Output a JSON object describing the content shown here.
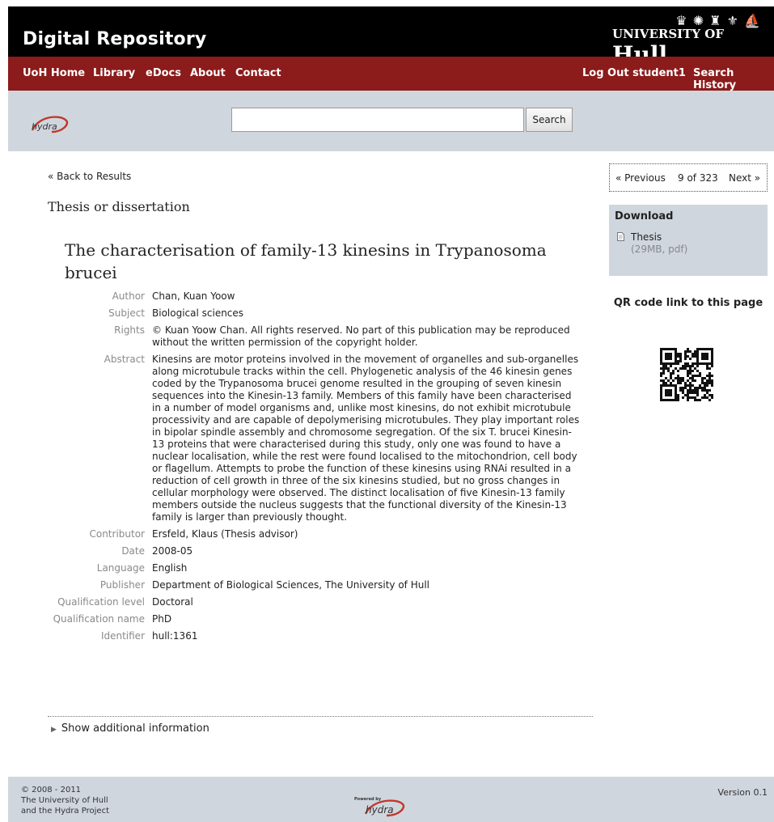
{
  "header": {
    "site_title": "Digital Repository",
    "uoh_logo_small": "UNIVERSITY OF",
    "uoh_logo_big": "Hull"
  },
  "nav": {
    "uoh_home": "UoH Home",
    "library": "Library",
    "edocs": "eDocs",
    "about": "About",
    "contact": "Contact",
    "logout": "Log Out student1",
    "search_history": "Search History"
  },
  "search": {
    "value": "",
    "button": "Search",
    "logo_text": "hydra"
  },
  "record": {
    "back": "« Back to Results",
    "type": "Thesis or dissertation",
    "title": "The characterisation of family-13 kinesins in Trypanosoma brucei",
    "fields": [
      {
        "label": "Author",
        "value": "Chan, Kuan Yoow"
      },
      {
        "label": "Subject",
        "value": "Biological sciences"
      },
      {
        "label": "Rights",
        "value": "© Kuan Yoow Chan. All rights reserved. No part of this publication may be reproduced without the written permission of the copyright holder."
      },
      {
        "label": "Abstract",
        "value": "Kinesins are motor proteins involved in the movement of organelles and sub-organelles along microtubule tracks within the cell. Phylogenetic analysis of the 46 kinesin genes coded by the Trypanosoma brucei genome resulted in the grouping of seven kinesin sequences into the Kinesin-13 family. Members of this family have been characterised in a number of model organisms and, unlike most kinesins, do not exhibit microtubule processivity and are capable of depolymerising microtubules. They play important roles in bipolar spindle assembly and chromosome segregation. Of the six T. brucei Kinesin-13 proteins that were characterised during this study, only one was found to have a nuclear localisation, while the rest were found localised to the mitochondrion, cell body or flagellum. Attempts to probe the function of these kinesins using RNAi resulted in a reduction of cell growth in three of the six kinesins studied, but no gross changes in cellular morphology were observed. The distinct localisation of five Kinesin-13 family members outside the nucleus suggests that the functional diversity of the Kinesin-13 family is larger than previously thought."
      },
      {
        "label": "Contributor",
        "value": "Ersfeld, Klaus (Thesis advisor)"
      },
      {
        "label": "Date",
        "value": "2008-05"
      },
      {
        "label": "Language",
        "value": "English"
      },
      {
        "label": "Publisher",
        "value": "Department of Biological Sciences, The University of Hull"
      },
      {
        "label": "Qualification level",
        "value": "Doctoral"
      },
      {
        "label": "Qualification name",
        "value": "PhD"
      },
      {
        "label": "Identifier",
        "value": "hull:1361"
      }
    ],
    "show_more": "Show additional information"
  },
  "sidebar": {
    "prev": "« Previous",
    "count": "9 of 323",
    "next": "Next »",
    "download_heading": "Download",
    "download_link": "Thesis",
    "download_meta": "(29MB, pdf)",
    "qr_title": "QR code link to this page"
  },
  "footer": {
    "copyright_line1": "© 2008 - 2011",
    "copyright_line2": "The University of Hull",
    "copyright_line3": "and the Hydra Project",
    "powered_small": "Powered by",
    "powered_logo": "hydra",
    "version": "Version 0.1"
  },
  "colors": {
    "header_bg": "#000000",
    "nav_bg": "#8c1b1b",
    "band_bg": "#d0d6de",
    "hydra_red": "#c0392b"
  },
  "icons": {
    "download": "pdf-file-icon",
    "qr": "qr-code-icon",
    "expand": "triangle-right-icon"
  }
}
